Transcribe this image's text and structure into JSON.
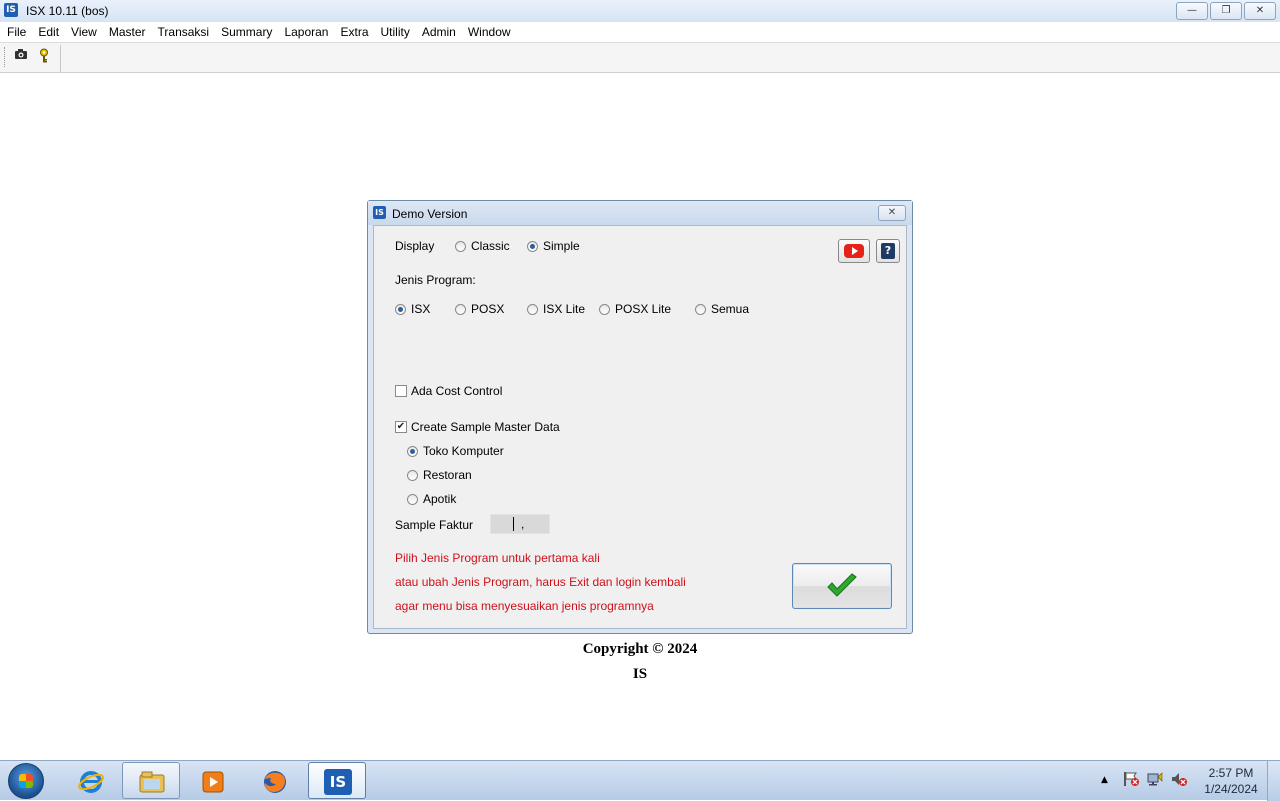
{
  "window": {
    "title": "ISX 10.11 (bos)",
    "app_icon_text": "IS",
    "minimize_icon": "minimize-icon",
    "restore_icon": "restore-icon",
    "close_icon": "close-icon"
  },
  "menu": [
    "File",
    "Edit",
    "View",
    "Master",
    "Transaksi",
    "Summary",
    "Laporan",
    "Extra",
    "Utility",
    "Admin",
    "Window"
  ],
  "toolbar": {
    "buttons": [
      {
        "icon": "camera-icon"
      },
      {
        "icon": "key-icon"
      }
    ]
  },
  "dialog": {
    "title": "Demo Version",
    "icon_text": "IS",
    "display_label": "Display",
    "display_options": [
      {
        "label": "Classic",
        "selected": false
      },
      {
        "label": "Simple",
        "selected": true
      }
    ],
    "youtube_icon": "youtube-icon",
    "help_icon": "help-icon",
    "help_glyph": "?",
    "jenis_label": "Jenis Program:",
    "jenis_options": [
      {
        "label": "ISX",
        "selected": true
      },
      {
        "label": "POSX",
        "selected": false
      },
      {
        "label": "ISX Lite",
        "selected": false
      },
      {
        "label": "POSX Lite",
        "selected": false
      },
      {
        "label": "Semua",
        "selected": false
      }
    ],
    "cost_control": {
      "label": "Ada Cost Control",
      "checked": false
    },
    "sample_master": {
      "label": "Create Sample Master Data",
      "checked": true
    },
    "sample_options": [
      {
        "label": "Toko Komputer",
        "selected": true
      },
      {
        "label": "Restoran",
        "selected": false
      },
      {
        "label": "Apotik",
        "selected": false
      }
    ],
    "sample_faktur_label": "Sample Faktur",
    "sample_faktur_value": ",",
    "notes": [
      "Pilih Jenis Program untuk pertama kali",
      "atau ubah Jenis Program, harus Exit dan login kembali",
      "agar menu bisa menyesuaikan jenis programnya"
    ],
    "ok_icon": "checkmark-icon",
    "colors": {
      "note_text": "#d0101a",
      "ok_check": "#2fa82f"
    }
  },
  "footer": {
    "copyright": "Copyright © 2024",
    "company": "IS"
  },
  "taskbar": {
    "start_icon": "windows-start-icon",
    "items": [
      {
        "icon": "internet-explorer-icon",
        "state": "pinned"
      },
      {
        "icon": "file-explorer-icon",
        "state": "open"
      },
      {
        "icon": "media-player-icon",
        "state": "pinned"
      },
      {
        "icon": "firefox-icon",
        "state": "pinned"
      },
      {
        "icon": "isx-app-icon",
        "state": "active",
        "text": "IS"
      }
    ],
    "tray": {
      "show_hidden_icon": "up-arrow-icon",
      "icons": [
        "action-center-flag-icon",
        "network-icon",
        "volume-muted-icon"
      ],
      "time": "2:57 PM",
      "date": "1/24/2024"
    }
  }
}
